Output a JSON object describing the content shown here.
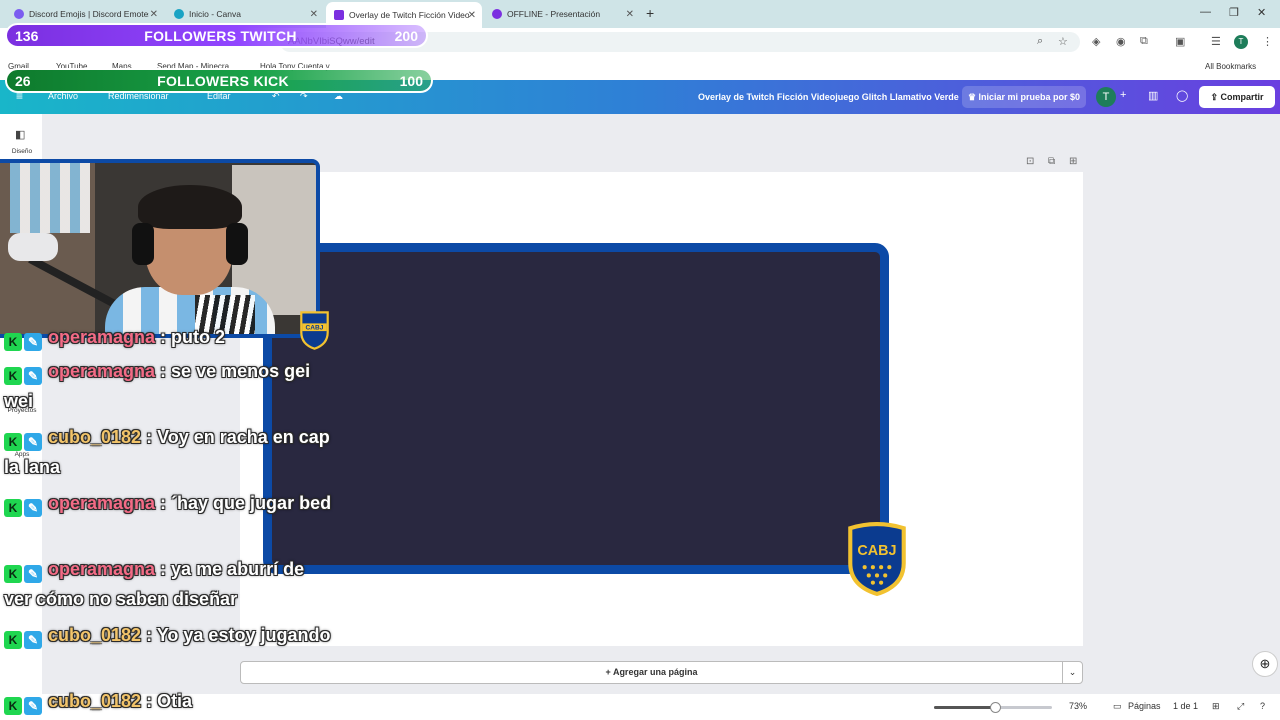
{
  "browser": {
    "tabs": [
      {
        "title": "Discord Emojis | Discord Emotes",
        "active": false,
        "color": "#7b5cf0"
      },
      {
        "title": "Inicio - Canva",
        "active": false,
        "color": "#1aa3c4"
      },
      {
        "title": "Overlay de Twitch Ficción Videojuego",
        "active": true,
        "color": "#7b2fe0"
      },
      {
        "title": "OFFLINE - Presentación",
        "active": false,
        "color": "#7b2fe0"
      }
    ],
    "url": "AANbVIbiSQww/edit",
    "bookmarks": [
      "Gmail",
      "YouTube",
      "Maps",
      "Send Map - Minecra...",
      "Hola Tony Cuenta y..."
    ],
    "all_bookmarks": "All Bookmarks",
    "profile_initial": "T"
  },
  "canva": {
    "menu": {
      "file": "Archivo",
      "resize": "Redimensionar",
      "edit": "Editar"
    },
    "design_title": "Overlay de Twitch Ficción Videojuego Glitch Llamativo Verde",
    "trial_button": "Iniciar mi prueba por $0",
    "avatar_initial": "T",
    "share_button": "Compartir",
    "rail": {
      "design": "Diseño",
      "projects": "Proyectos",
      "apps": "Apps"
    },
    "add_page": "+ Agregar una página",
    "zoom_label": "73%",
    "zoom_fraction": 0.52,
    "pages_label": "Páginas",
    "page_count": "1 de 1",
    "colors": {
      "header_start": "#19b6c9",
      "header_end": "#6a3fe0",
      "frame_border": "#0c4aa6",
      "frame_fill": "#292840"
    }
  },
  "overlay": {
    "twitch": {
      "count": "136",
      "label": "FOLLOWERS TWITCH",
      "goal": "200",
      "progress": 0.68,
      "color": "#9146ff"
    },
    "kick": {
      "count": "26",
      "label": "FOLLOWERS KICK",
      "goal": "100",
      "progress": 0.26,
      "color": "#1aa34a"
    },
    "badge_text": "CABJ",
    "chat": [
      {
        "user": "operamagna",
        "sep": " :",
        "text": " puto 2",
        "color": "pink"
      },
      {
        "user": "operamagna",
        "sep": " :",
        "text": " se ve menos gei wei",
        "color": "pink"
      },
      {
        "user": "cubo_0182",
        "sep": " :",
        "text": " Voy en racha en cap la lana",
        "color": "gold"
      },
      {
        "user": "operamagna",
        "sep": " :",
        "text": " ´hay que jugar bed",
        "color": "pink"
      },
      {
        "user": "operamagna",
        "sep": " :",
        "text": " ya me aburrí de ver cómo no saben diseñar",
        "color": "pink"
      },
      {
        "user": "cubo_0182",
        "sep": " :",
        "text": " Yo ya estoy jugando",
        "color": "gold"
      },
      {
        "user": "cubo_0182",
        "sep": " :",
        "text": " Otia",
        "color": "gold"
      }
    ]
  }
}
